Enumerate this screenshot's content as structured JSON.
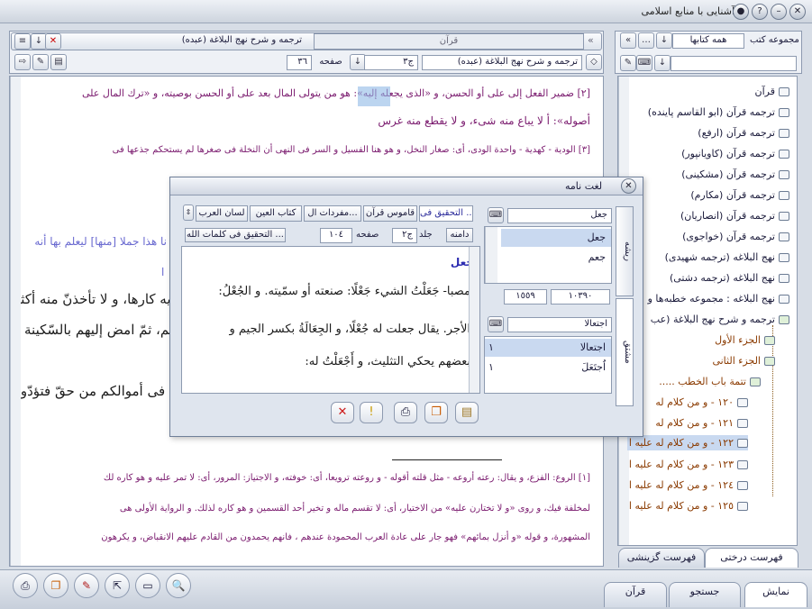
{
  "app": {
    "title": "آشنایی با منابع اسلامی"
  },
  "reader": {
    "tab_left": "قرآن",
    "tab_right": "ترجمه و شرح نهج البلاغة (عبده)",
    "book_field": "ترجمه و شرح نهج البلاغة (عبده)",
    "volume_field": "ج٣",
    "page_label": "صفحه",
    "page_value": "٣٦",
    "lines": [
      "[٢] ضمير الفعل إلى على أو الحسن، و «الذی يجعله إليه»: هو من يتولى المال بعد على أو الحسن بوصيته، و «ترك المال على",
      "أصوله»: أ لا يباع منه شیء، و لا يقطع منه غرس",
      "[٣] الودية - كهدية - واحدة الودى، أی: صغار النخل، و هو هنا الفسيل و السر فی النهی أن النخلة فی صغرها لم يستحكم جذعها فی",
      "نا هذا جملا [منها] ليعلم بها أنه",
      "ا",
      "يه كارها، و لا تأخذنّ منه أكثر",
      "هم، ثمّ امض إليهم بالسّكينة و",
      "ه فی أموالكم من حقّ فتؤدّوه",
      "[١] الروع: الفزع، و يقال: رعته أروعه - مثل قلته أقوله - و روعته ترويعا، أی: خوفته، و الاجتياز: المرور، أی: لا تمر عليه و هو كاره لك",
      "لمخلفة فيك، و روى «و لا تختارن عليه» من الاختيار، أی: لا تقسم ماله و تخير أحد القسمين و هو كاره لذلك. و الرواية الأولى هی",
      "المشهورة، و قوله «و أنزل بمائهم» فهو جار على عادة العرب المحمودة عندهم ، فانهم يحمدون من القادم عليهم الانقباض، و يكرهون"
    ]
  },
  "library": {
    "header_label": "مجموعه كتب",
    "combo": "همه كتابها",
    "items": [
      "قرآن",
      "ترجمه قرآن (ابو القاسم پاينده)",
      "ترجمه قرآن (ارفع)",
      "ترجمه قرآن (كاويانپور)",
      "ترجمه قرآن (مشكينی)",
      "ترجمه قرآن (مكارم)",
      "ترجمه قرآن (انصاريان)",
      "ترجمه قرآن (خواجوی)",
      "نهج البلاغه (ترجمه شهيدی)",
      "نهج البلاغه (ترجمه دشتی)",
      "نهج البلاغه : مجموعه خطبه‌ها و",
      "ترجمه و شرح نهج البلاغة (عب",
      "الجزء الأول",
      "الجزء الثانی",
      "تتمة باب الخطب .....",
      "١٢٠ - و من كلام له",
      "١٢١ - و من كلام له",
      "١٢٢ - و من كلام له عليه ا",
      "١٢٣ - و من كلام له عليه ا",
      "١٢٤ - و من كلام له عليه ا",
      "١٢٥ - و من كلام له عليه ا"
    ],
    "tabs": [
      "فهرست درختی",
      "فهرست گزينشی"
    ]
  },
  "dictionary": {
    "title": "لغت نامه",
    "tabs": [
      "التحقيق فی ...",
      "قاموس قرآن",
      "مفردات ال...",
      "كتاب العين",
      "لسان العرب"
    ],
    "vtabs": [
      "ريشه",
      "مشتق"
    ],
    "search_root": "جعل",
    "roots": [
      "جعل",
      "جعم"
    ],
    "range_from": "١٠٣٩٠",
    "range_to": "١٥٥٩",
    "search_derivative": "اجتعالا",
    "derivatives": [
      {
        "word": "اجتعالا",
        "count": "١"
      },
      {
        "word": "اُجتَعَلَ",
        "count": "١"
      }
    ],
    "source_label": "دامنه",
    "vol_label": "جلد",
    "vol": "ج٢",
    "page_label": "صفحه",
    "page": "١٠٤",
    "book": "التحقيق فی كلمات الله ...",
    "heading": "جعل",
    "text": [
      "مصبا- جَعَلْتُ الشيء جَعْلًا: صنعته أو سمّيته. و الجُعْلُ:",
      "الأجر. يقال جعلت له جُعْلًا، و الجِعَالَةُ بكسر الجيم و",
      "بعضهم يحكي التثليث، و أَجْعَلْتُ له:"
    ]
  },
  "bottom": {
    "tabs": [
      "نمايش",
      "جستجو",
      "قرآن"
    ]
  }
}
